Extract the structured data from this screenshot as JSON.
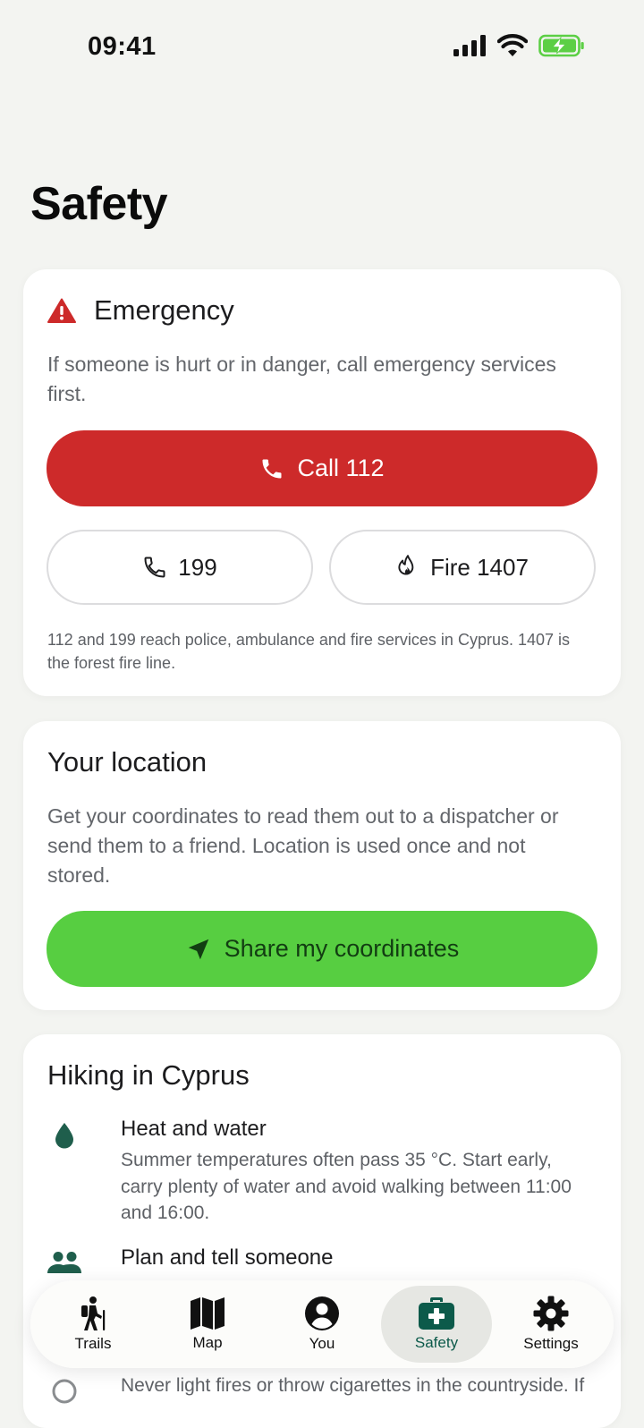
{
  "status": {
    "time": "09:41"
  },
  "page": {
    "title": "Safety"
  },
  "emergency": {
    "title": "Emergency",
    "description": "If someone is hurt or in danger, call emergency services first.",
    "call_label": "Call 112",
    "alt_label": "199",
    "fire_label": "Fire 1407",
    "note": "112 and 199 reach police, ambulance and fire services in Cyprus. 1407 is the forest fire line."
  },
  "location": {
    "title": "Your location",
    "description": "Get your coordinates to read them out to a dispatcher or send them to a friend. Location is used once and not stored.",
    "share_label": "Share my coordinates"
  },
  "hiking": {
    "title": "Hiking in Cyprus",
    "tips": [
      {
        "title": "Heat and water",
        "text": "Summer temperatures often pass 35 °C. Start early, carry plenty of water and avoid walking between 11:00 and 16:00."
      },
      {
        "title": "Plan and tell someone",
        "text": ""
      },
      {
        "title": "",
        "text": "Never light fires or throw cigarettes in the countryside. If"
      }
    ]
  },
  "tabs": [
    {
      "label": "Trails",
      "icon": "hiker-icon"
    },
    {
      "label": "Map",
      "icon": "map-icon"
    },
    {
      "label": "You",
      "icon": "person-icon"
    },
    {
      "label": "Safety",
      "icon": "first-aid-icon"
    },
    {
      "label": "Settings",
      "icon": "gear-icon"
    }
  ],
  "colors": {
    "emergency_red": "#cd2a2a",
    "share_green": "#57ce41",
    "tip_icon_green": "#1f5e4c",
    "active_tab": "#0c5a4a",
    "background": "#f3f4f1"
  }
}
